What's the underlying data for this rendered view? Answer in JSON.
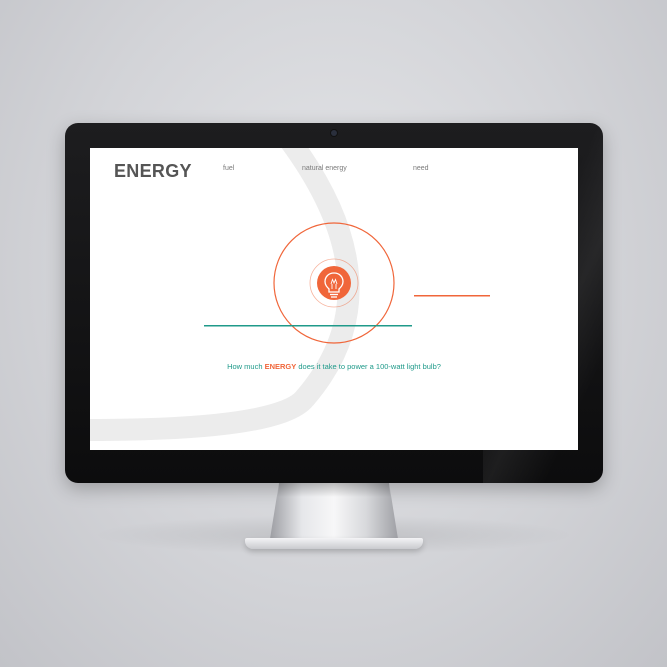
{
  "brand": {
    "title": "ENERGY"
  },
  "nav": {
    "items": [
      {
        "label": "fuel"
      },
      {
        "label": "natural energy"
      },
      {
        "label": "need"
      }
    ]
  },
  "hero": {
    "icon": "lightbulb-icon",
    "question": {
      "before": "How much ",
      "highlight": "ENERGY",
      "after": " does it take to power a 100-watt light bulb?"
    }
  },
  "colors": {
    "brand_text": "#555555",
    "accent_orange": "#f0663a",
    "accent_teal": "#1f9a8a",
    "nav_text": "#7a7a7a",
    "deco_arc": "#ececec"
  }
}
